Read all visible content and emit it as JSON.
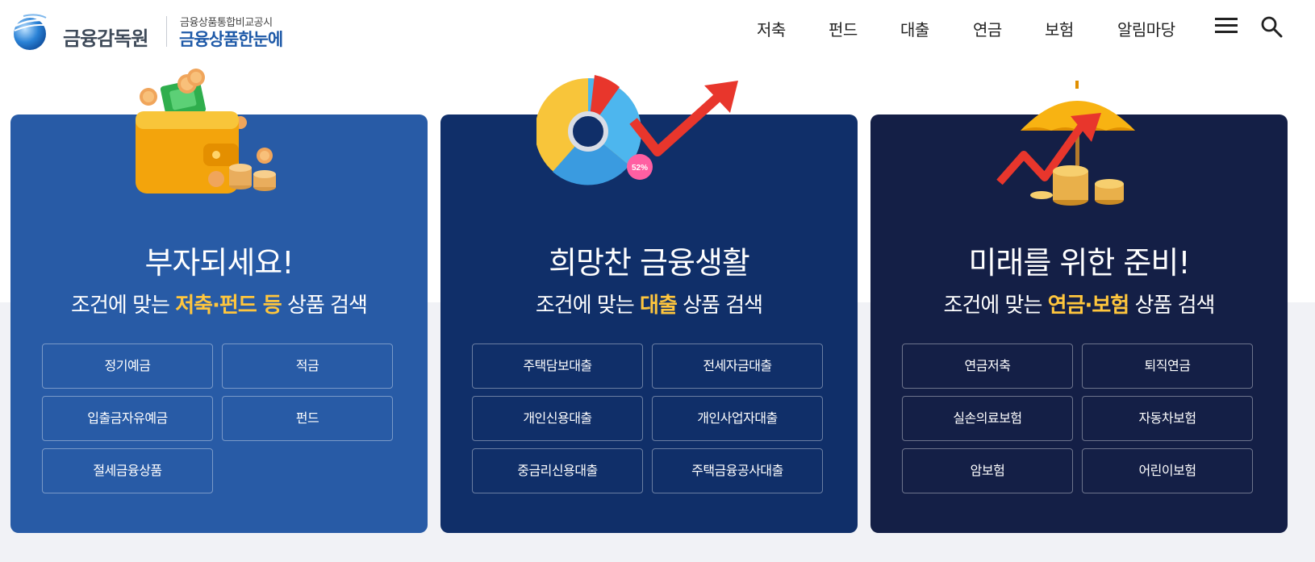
{
  "header": {
    "org_name": "금융감독원",
    "sub_small": "금융상품통합비교공시",
    "sub_big": "금융상품한눈에",
    "nav": [
      "저축",
      "펀드",
      "대출",
      "연금",
      "보험",
      "알림마당"
    ]
  },
  "cards": [
    {
      "headline": "부자되세요!",
      "sub_prefix": "조건에 맞는 ",
      "sub_highlight": "저축·펀드 등",
      "sub_suffix": " 상품 검색",
      "buttons": [
        "정기예금",
        "적금",
        "입출금자유예금",
        "펀드",
        "절세금융상품"
      ]
    },
    {
      "headline": "희망찬 금융생활",
      "sub_prefix": "조건에 맞는 ",
      "sub_highlight": "대출",
      "sub_suffix": " 상품 검색",
      "buttons": [
        "주택담보대출",
        "전세자금대출",
        "개인신용대출",
        "개인사업자대출",
        "중금리신용대출",
        "주택금융공사대출"
      ],
      "chart_badge": "52%"
    },
    {
      "headline": "미래를 위한 준비!",
      "sub_prefix": "조건에 맞는 ",
      "sub_highlight": "연금·보험",
      "sub_suffix": " 상품 검색",
      "buttons": [
        "연금저축",
        "퇴직연금",
        "실손의료보험",
        "자동차보험",
        "암보험",
        "어린이보험"
      ]
    }
  ],
  "colors": {
    "card1": "#285ba6",
    "card2": "#102f69",
    "card3": "#141f46",
    "highlight": "#ffc63d",
    "brand": "#1f5aa8"
  },
  "icons": [
    "globe-logo-icon",
    "hamburger-menu-icon",
    "search-icon"
  ]
}
